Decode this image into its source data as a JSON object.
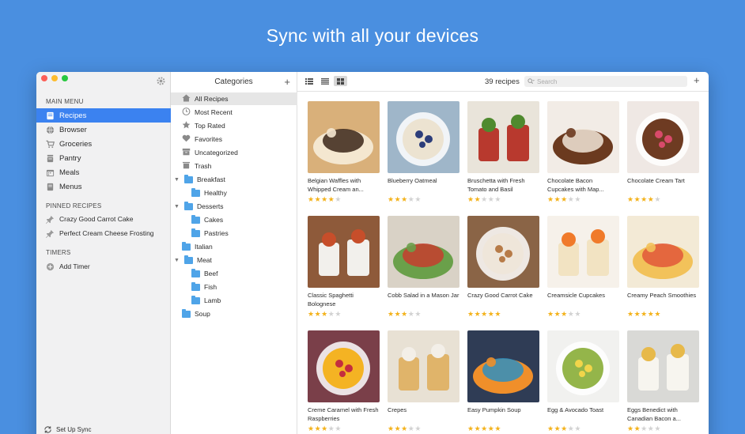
{
  "headline": "Sync with all your devices",
  "colors": {
    "background": "#4a8fe0",
    "accent": "#3b82f0",
    "star": "#f3b21b",
    "folder": "#4fa4e8"
  },
  "sidebar": {
    "main_menu_header": "MAIN MENU",
    "items": [
      {
        "label": "Recipes",
        "icon": "recipes-icon",
        "active": true
      },
      {
        "label": "Browser",
        "icon": "globe-icon"
      },
      {
        "label": "Groceries",
        "icon": "cart-icon"
      },
      {
        "label": "Pantry",
        "icon": "pantry-icon"
      },
      {
        "label": "Meals",
        "icon": "calendar-icon"
      },
      {
        "label": "Menus",
        "icon": "menu-book-icon"
      }
    ],
    "pinned_header": "PINNED RECIPES",
    "pinned": [
      {
        "label": "Crazy Good Carrot Cake",
        "icon": "pin-icon"
      },
      {
        "label": "Perfect Cream Cheese Frosting",
        "icon": "pin-icon"
      }
    ],
    "timers_header": "TIMERS",
    "add_timer": "Add Timer",
    "sync_label": "Set Up Sync"
  },
  "categories": {
    "title": "Categories",
    "items": [
      {
        "label": "All Recipes",
        "icon": "home-icon",
        "selected": true
      },
      {
        "label": "Most Recent",
        "icon": "clock-icon"
      },
      {
        "label": "Top Rated",
        "icon": "star-icon"
      },
      {
        "label": "Favorites",
        "icon": "heart-icon"
      },
      {
        "label": "Uncategorized",
        "icon": "box-icon"
      },
      {
        "label": "Trash",
        "icon": "trash-icon"
      },
      {
        "label": "Breakfast",
        "icon": "folder-icon",
        "expanded": true
      },
      {
        "label": "Healthy",
        "icon": "folder-icon",
        "child": true
      },
      {
        "label": "Desserts",
        "icon": "folder-icon",
        "expanded": true
      },
      {
        "label": "Cakes",
        "icon": "folder-icon",
        "child": true
      },
      {
        "label": "Pastries",
        "icon": "folder-icon",
        "child": true
      },
      {
        "label": "Italian",
        "icon": "folder-icon"
      },
      {
        "label": "Meat",
        "icon": "folder-icon",
        "expanded": true
      },
      {
        "label": "Beef",
        "icon": "folder-icon",
        "child": true
      },
      {
        "label": "Fish",
        "icon": "folder-icon",
        "child": true
      },
      {
        "label": "Lamb",
        "icon": "folder-icon",
        "child": true
      },
      {
        "label": "Soup",
        "icon": "folder-icon"
      }
    ]
  },
  "toolbar": {
    "count": "39 recipes",
    "search_placeholder": "Search",
    "views": [
      "list-view-icon",
      "detail-view-icon",
      "grid-view-icon"
    ],
    "active_view": "grid-view-icon"
  },
  "recipes": [
    {
      "title": "Belgian Waffles with Whipped Cream an...",
      "rating": 4,
      "bg": "#d9b07a",
      "fg": "#f4e7d0",
      "acc": "#3a2418"
    },
    {
      "title": "Blueberry Oatmeal",
      "rating": 3,
      "bg": "#9fb6c9",
      "fg": "#ece3d1",
      "acc": "#2c3d7a"
    },
    {
      "title": "Bruschetta with Fresh Tomato and Basil",
      "rating": 2,
      "bg": "#e9e4da",
      "fg": "#b8392e",
      "acc": "#4f8a2e"
    },
    {
      "title": "Chocolate Bacon Cupcakes with Map...",
      "rating": 3,
      "bg": "#f2ece6",
      "fg": "#6b3a1f",
      "acc": "#f1e6d8"
    },
    {
      "title": "Chocolate Cream Tart",
      "rating": 4,
      "bg": "#efe8e4",
      "fg": "#6e3b22",
      "acc": "#d84a6a"
    },
    {
      "title": "Classic Spaghetti Bolognese",
      "rating": 3,
      "bg": "#8e5a3a",
      "fg": "#f2f0ec",
      "acc": "#c74e2a"
    },
    {
      "title": "Cobb Salad in a Mason Jar",
      "rating": 3,
      "bg": "#d9d2c6",
      "fg": "#6aa04a",
      "acc": "#c63d2e"
    },
    {
      "title": "Crazy Good Carrot Cake",
      "rating": 5,
      "bg": "#8a6446",
      "fg": "#efe6da",
      "acc": "#b77b48"
    },
    {
      "title": "Creamsicle Cupcakes",
      "rating": 3,
      "bg": "#f6f1ea",
      "fg": "#f2e3c2",
      "acc": "#f07a2a"
    },
    {
      "title": "Creamy Peach Smoothies",
      "rating": 5,
      "bg": "#f3ead6",
      "fg": "#f2c25a",
      "acc": "#e2573a"
    },
    {
      "title": "Creme Caramel with Fresh Raspberries",
      "rating": 3,
      "bg": "#7a3f49",
      "fg": "#f4b323",
      "acc": "#c42d3e"
    },
    {
      "title": "Crepes",
      "rating": 3,
      "bg": "#e8e1d4",
      "fg": "#e0b46a",
      "acc": "#f3efe8"
    },
    {
      "title": "Easy Pumpkin Soup",
      "rating": 5,
      "bg": "#2f3c55",
      "fg": "#f08f2a",
      "acc": "#2f8fbf"
    },
    {
      "title": "Egg & Avocado Toast",
      "rating": 3,
      "bg": "#f1f1ef",
      "fg": "#94b54a",
      "acc": "#f2d54a"
    },
    {
      "title": "Eggs Benedict with Canadian Bacon a...",
      "rating": 2,
      "bg": "#d9d9d6",
      "fg": "#f7f5ef",
      "acc": "#e7b94a"
    }
  ]
}
